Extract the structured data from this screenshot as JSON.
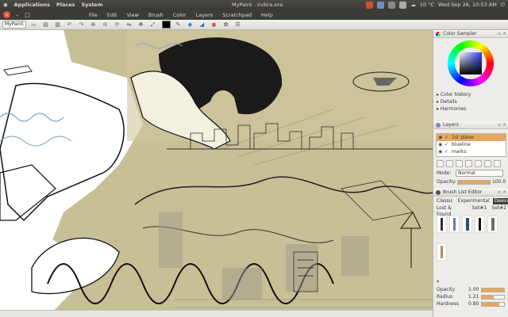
{
  "panel": {
    "menus": [
      "Applications",
      "Places",
      "System"
    ],
    "window_title": "MyPaint - indice.ora",
    "temperature": "10 °C",
    "clock": "Wed Sep 26, 10:53 AM"
  },
  "menubar": {
    "items": [
      "File",
      "Edit",
      "View",
      "Brush",
      "Color",
      "Layers",
      "Scratchpad",
      "Help"
    ]
  },
  "toolbar": {
    "app_menu": "MyPaint",
    "color_swatch": "#000000"
  },
  "side": {
    "color_sampler": {
      "title": "Color Sampler",
      "items": [
        "Color history",
        "Details",
        "Harmonies"
      ]
    },
    "layers": {
      "title": "Layers",
      "list": [
        {
          "name": "1st plane",
          "selected": true
        },
        {
          "name": "blueline",
          "selected": false
        },
        {
          "name": "marks",
          "selected": false
        }
      ],
      "mode_label": "Mode:",
      "mode_value": "Normal",
      "opacity_label": "Opacity:",
      "opacity_value": "100.0",
      "opacity_fraction": 1.0
    },
    "brush_list": {
      "title": "Brush List Editor",
      "tabs": [
        "Classic",
        "Experimental",
        "Deevad"
      ],
      "tabs2": [
        "Lost & Found",
        "Set#1",
        "Set#2"
      ],
      "brush_icons": [
        "pencil-brush-icon",
        "pen-brush-icon",
        "marker-brush-icon",
        "ink-brush-icon",
        "charcoal-brush-icon",
        "blend-brush-icon"
      ],
      "settings": [
        {
          "label": "Opacity",
          "value": "1.00",
          "fraction": 1.0
        },
        {
          "label": "Radius",
          "value": "1.21",
          "fraction": 0.55
        },
        {
          "label": "Hardness",
          "value": "0.80",
          "fraction": 0.8
        }
      ]
    }
  },
  "colors": {
    "accent": "#e6a75c",
    "panel_bg": "#3c3b37",
    "canvas_bg": "#c7bf95"
  }
}
